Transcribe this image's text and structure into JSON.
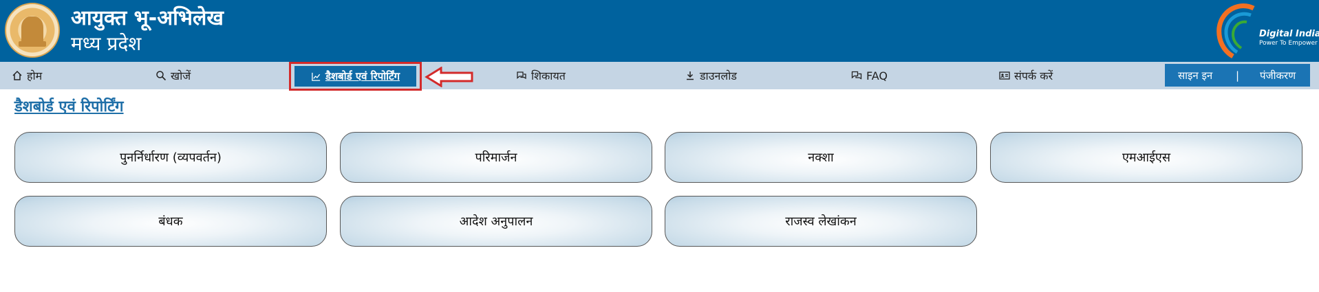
{
  "header": {
    "title_line1": "आयुक्त भू-अभिलेख",
    "title_line2": "मध्य प्रदेश",
    "logo_text": "Digital India",
    "logo_tagline": "Power To Empower"
  },
  "nav": {
    "home": "होम",
    "search": "खोजें",
    "dashboard": "डैशबोर्ड एवं रिपोर्टिंग",
    "complaint": "शिकायत",
    "download": "डाउनलोड",
    "faq": "FAQ",
    "contact": "संपर्क करें",
    "sign_in": "साइन इन",
    "separator": "|",
    "register": "पंजीकरण"
  },
  "page": {
    "heading": "डैशबोर्ड एवं रिपोर्टिंग"
  },
  "tiles": [
    "पुनर्निर्धारण (व्यपवर्तन)",
    "परिमार्जन",
    "नक्शा",
    "एमआईएस",
    "बंधक",
    "आदेश अनुपालन",
    "राजस्व लेखांकन"
  ],
  "colors": {
    "header_bg": "#00629e",
    "nav_bg": "#c5d5e4",
    "active_tab": "#0f6aa6",
    "highlight_red": "#d32a2a",
    "heading_link": "#1f6fa8"
  }
}
